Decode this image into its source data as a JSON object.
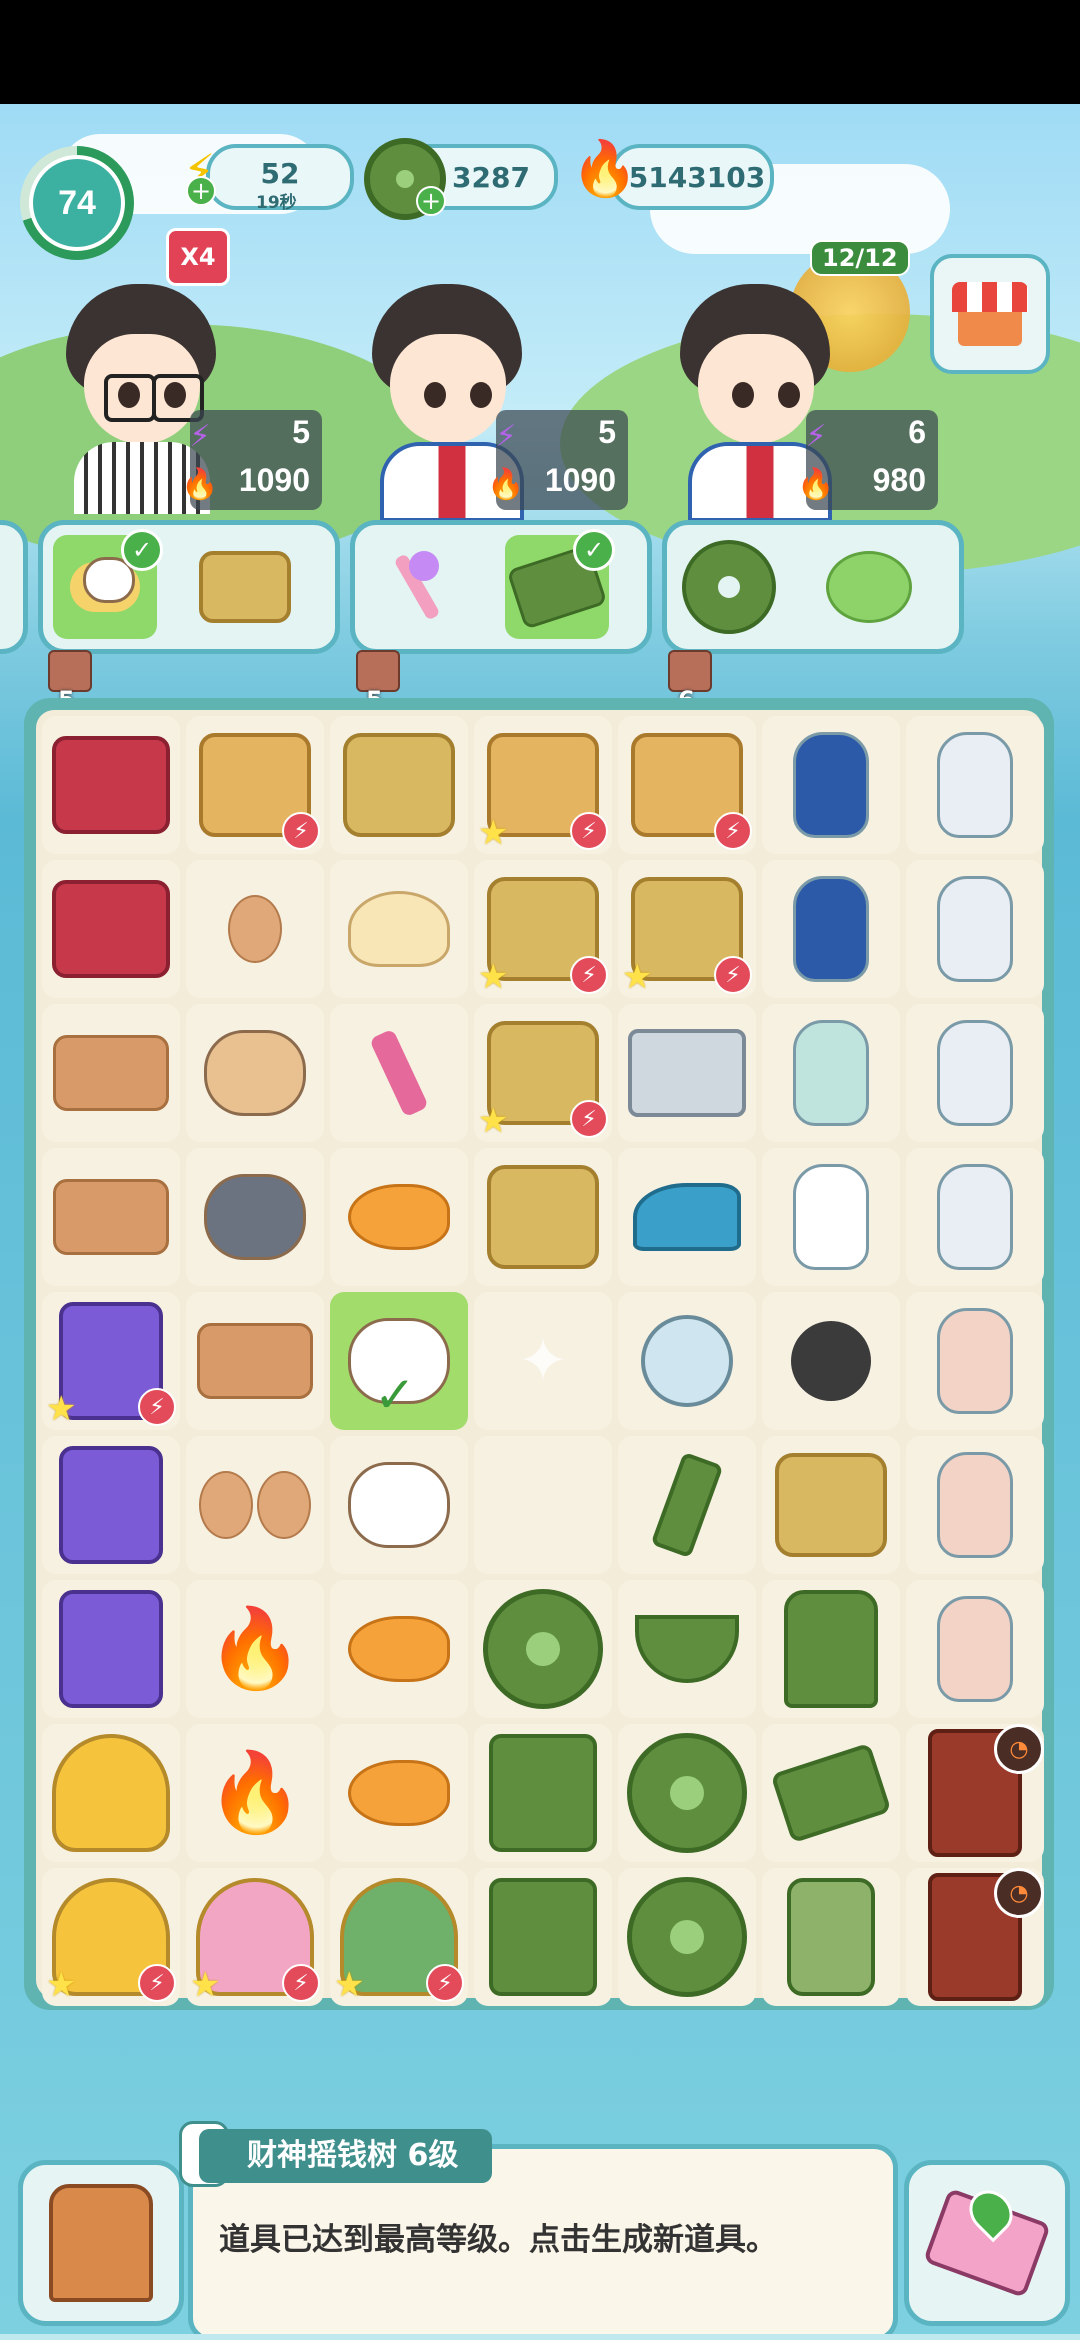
{
  "hud": {
    "level": "74",
    "energy": {
      "value": "52",
      "timer": "19秒"
    },
    "jade_coins": "3287",
    "blue_flame": "5143103",
    "multiplier": "X4",
    "vip_counter": "12/12"
  },
  "customers": [
    {
      "name_icon": "customer-glasses",
      "lightning": "5",
      "flame": "1090"
    },
    {
      "name_icon": "customer-suit",
      "lightning": "5",
      "flame": "1090"
    },
    {
      "name_icon": "customer-suit",
      "lightning": "6",
      "flame": "980"
    }
  ],
  "orders": [
    {
      "items": [
        "cat-on-cushion",
        "steamer-with-fruit"
      ],
      "done": [
        true,
        false
      ],
      "box_count": "5"
    },
    {
      "items": [
        "magic-wand",
        "jade-tile"
      ],
      "done": [
        false,
        true
      ],
      "box_count": "5"
    },
    {
      "items": [
        "jade-disc",
        "lotus-leaf"
      ],
      "done": [
        false,
        false
      ],
      "box_count": "6"
    }
  ],
  "board": {
    "rows": [
      [
        "gift-basket-red",
        "treasure-chest-gold",
        "bamboo-steamer-open",
        "wok-noodles",
        "food-stall",
        "blue-vase",
        "porcelain-jar-ornate"
      ],
      [
        "picnic-basket",
        "egg",
        "steamed-bun",
        "steamer-buns",
        "steamer-buns",
        "small-blue-vase",
        "porcelain-jar-ornate"
      ],
      [
        "egg-carton-12",
        "calico-cat-bed",
        "lipstick",
        "steamer-buns",
        "microwave",
        "celadon-vase",
        "porcelain-jar-ornate"
      ],
      [
        "egg-tray",
        "gray-cat-bed",
        "fish-cake",
        "dim-sum-tower",
        "steam-iron",
        "white-vase",
        "porcelain-jar-ornate"
      ],
      [
        "purple-wardrobe",
        "egg-tray-small",
        "white-cat",
        "empty-sparkle",
        "electric-fan",
        "frying-pan",
        "flower-vase"
      ],
      [
        "electric-guitar",
        "two-eggs",
        "small-cat",
        "empty",
        "jade-tube",
        "bamboo-steamer",
        "flower-vase"
      ],
      [
        "violin-stand",
        "blue-flame-small",
        "goldfish",
        "jade-dragon-disc",
        "jade-arc",
        "jade-bell",
        "flower-vase"
      ],
      [
        "gold-treasure-pot",
        "blue-flame-large",
        "koi-fish",
        "jade-cong",
        "jade-dragon-disc",
        "jade-tile",
        "wooden-loom"
      ],
      [
        "money-tree",
        "lotus-bonsai",
        "landscape-bonsai",
        "jade-cong",
        "jade-dragon-disc",
        "jade-tablet",
        "wooden-loom"
      ]
    ],
    "selected": [
      4,
      2
    ]
  },
  "info": {
    "title": "财神摇钱树 6级",
    "text": "道具已达到最高等级。点击生成新道具。"
  },
  "colors": {
    "panel_border": "#5ab4c2",
    "board_bg": "#f3ecd9",
    "selected_cell": "#a2dc6a",
    "accent_red": "#e34b5a",
    "jade": "#5f8f3e"
  }
}
